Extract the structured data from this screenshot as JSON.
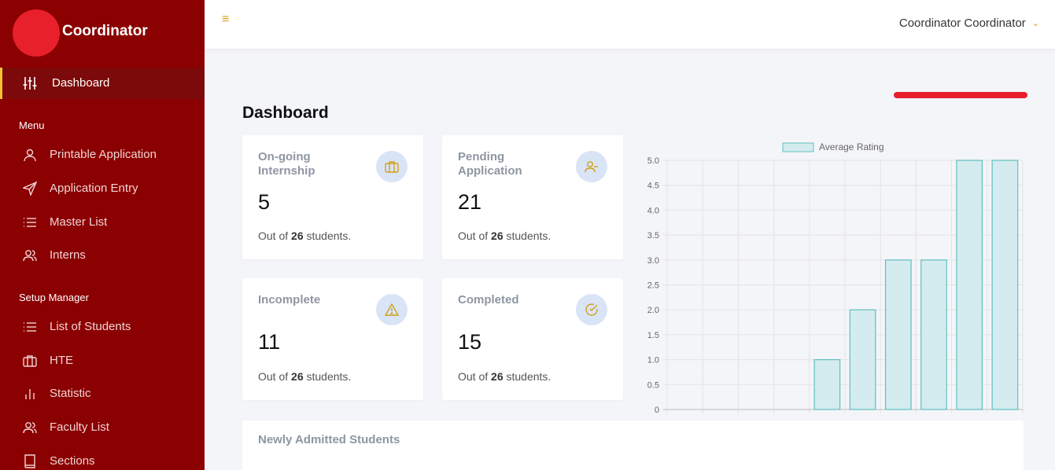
{
  "brand": {
    "name": "Coordinator"
  },
  "sidebar": {
    "active": {
      "label": "Dashboard",
      "icon": "sliders-icon"
    },
    "menu_section": "Menu",
    "menu_items": [
      {
        "label": "Printable Application",
        "icon": "user-icon"
      },
      {
        "label": "Application Entry",
        "icon": "send-icon"
      },
      {
        "label": "Master List",
        "icon": "list-icon"
      },
      {
        "label": "Interns",
        "icon": "users-icon"
      }
    ],
    "setup_section": "Setup Manager",
    "setup_items": [
      {
        "label": "List of Students",
        "icon": "list-icon"
      },
      {
        "label": "HTE",
        "icon": "briefcase-icon"
      },
      {
        "label": "Statistic",
        "icon": "bar-chart-icon"
      },
      {
        "label": "Faculty List",
        "icon": "users-icon"
      },
      {
        "label": "Sections",
        "icon": "book-icon"
      }
    ]
  },
  "topbar": {
    "user_name": "Coordinator Coordinator"
  },
  "page": {
    "title": "Dashboard"
  },
  "cards": [
    {
      "title": "On-going Internship",
      "value": "5",
      "foot_prefix": "Out of",
      "foot_total": "26",
      "foot_suffix": "students.",
      "icon": "briefcase-icon"
    },
    {
      "title": "Pending Application",
      "value": "21",
      "foot_prefix": "Out of",
      "foot_total": "26",
      "foot_suffix": "students.",
      "icon": "user-minus-icon"
    },
    {
      "title": "Incomplete",
      "value": "11",
      "foot_prefix": "Out of",
      "foot_total": "26",
      "foot_suffix": "students.",
      "icon": "alert-triangle-icon"
    },
    {
      "title": "Completed",
      "value": "15",
      "foot_prefix": "Out of",
      "foot_total": "26",
      "foot_suffix": "students.",
      "icon": "check-circle-icon"
    }
  ],
  "bottom": {
    "title": "Newly Admitted Students"
  },
  "colors": {
    "sidebar": "#8b0000",
    "accent": "#d4a017",
    "bar_fill": "#d4ecef",
    "bar_stroke": "#5fbfbf"
  },
  "chart_data": {
    "type": "bar",
    "legend": [
      "Average Rating"
    ],
    "categories": [
      "",
      "",
      "",
      "",
      "",
      "",
      "",
      "",
      "",
      ""
    ],
    "series": [
      {
        "name": "Average Rating",
        "values": [
          0,
          0,
          0,
          0,
          1,
          2,
          3,
          3,
          5,
          5
        ]
      }
    ],
    "ylim": [
      0,
      5
    ],
    "yticks": [
      "0",
      "0.5",
      "1.0",
      "1.5",
      "2.0",
      "2.5",
      "3.0",
      "3.5",
      "4.0",
      "4.5",
      "5.0"
    ],
    "grid": true,
    "legend_position": "top"
  }
}
